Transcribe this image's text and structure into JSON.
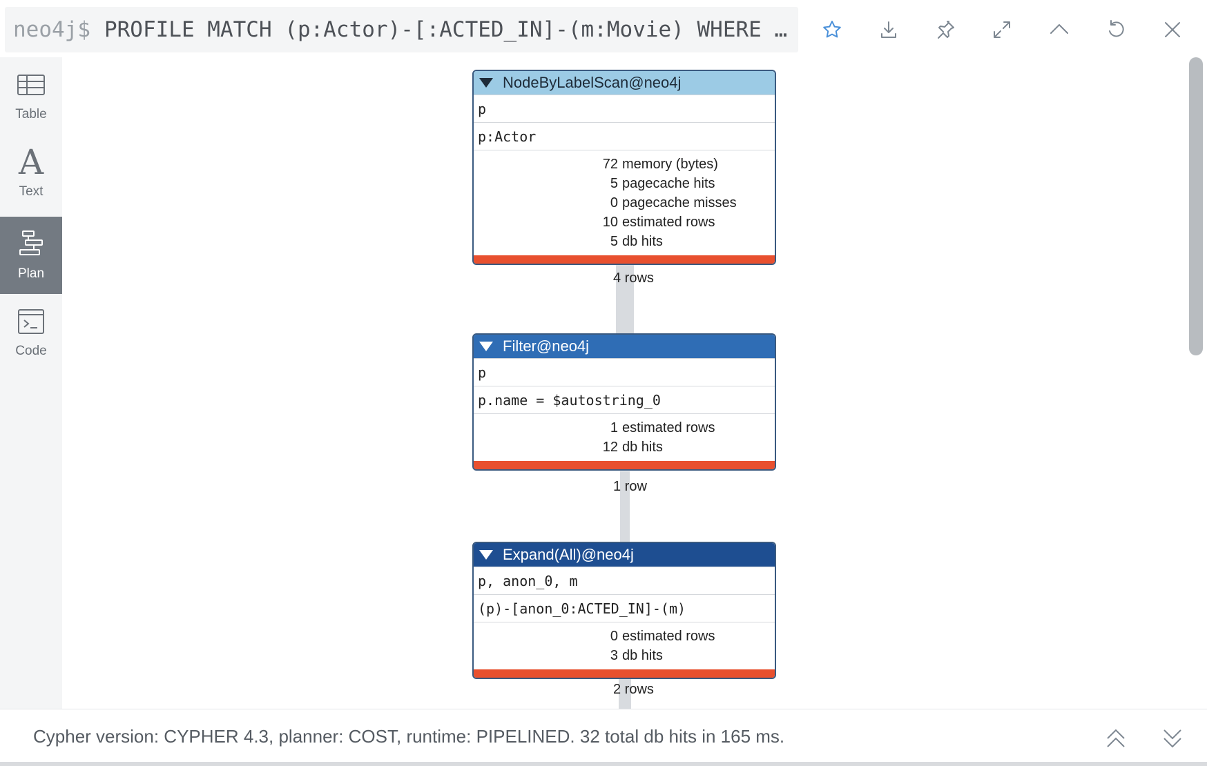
{
  "header": {
    "prompt": "neo4j$",
    "query": "PROFILE MATCH (p:Actor)-[:ACTED_IN]-(m:Movie) WHERE …",
    "icons": [
      "star-icon",
      "download-icon",
      "pin-icon",
      "expand-icon",
      "collapse-up-icon",
      "rerun-icon",
      "close-icon"
    ],
    "accent_color": "#4a90d9"
  },
  "sidebar": {
    "items": [
      {
        "label": "Table",
        "icon": "table-icon"
      },
      {
        "label": "Text",
        "icon": "text-icon",
        "glyph": "A"
      },
      {
        "label": "Plan",
        "icon": "plan-icon",
        "active": true
      },
      {
        "label": "Code",
        "icon": "code-icon"
      }
    ]
  },
  "plan": {
    "operators": [
      {
        "title": "NodeByLabelScan@neo4j",
        "identifiers": "p",
        "details": "p:Actor",
        "stats": [
          {
            "num": "72",
            "label": "memory (bytes)"
          },
          {
            "num": "5",
            "label": "pagecache hits"
          },
          {
            "num": "0",
            "label": "pagecache misses"
          },
          {
            "num": "10",
            "label": "estimated rows"
          },
          {
            "num": "5",
            "label": "db hits"
          }
        ],
        "header_color": "#9ccbe5"
      },
      {
        "title": "Filter@neo4j",
        "identifiers": "p",
        "details": "p.name = $autostring_0",
        "stats": [
          {
            "num": "1",
            "label": "estimated rows"
          },
          {
            "num": "12",
            "label": "db hits"
          }
        ],
        "header_color": "#2f6db5"
      },
      {
        "title": "Expand(All)@neo4j",
        "identifiers": "p, anon_0, m",
        "details": "(p)-[anon_0:ACTED_IN]-(m)",
        "stats": [
          {
            "num": "0",
            "label": "estimated rows"
          },
          {
            "num": "3",
            "label": "db hits"
          }
        ],
        "header_color": "#1e4e91"
      }
    ],
    "edges": [
      "4 rows",
      "1 row",
      "2 rows"
    ],
    "cost_bar_color": "#e8502f"
  },
  "footer": {
    "summary": "Cypher version: CYPHER 4.3, planner: COST, runtime: PIPELINED. 32 total db hits in 165 ms."
  }
}
